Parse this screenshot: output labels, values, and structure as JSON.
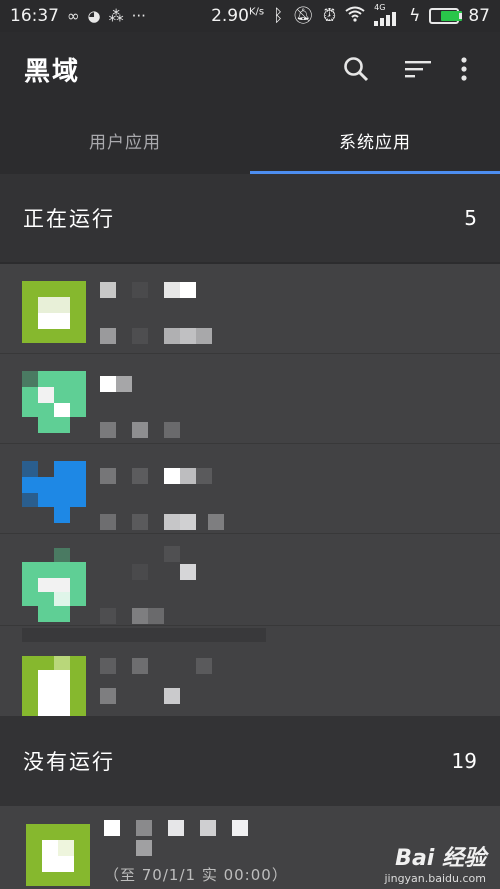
{
  "status_bar": {
    "time": "16:37",
    "speed_value": "2.90",
    "speed_unit": "K/s",
    "network": "4G",
    "battery": "87",
    "battery_level_percent": 87
  },
  "toolbar": {
    "title": "黑域",
    "icons": [
      "search-icon",
      "sort-icon",
      "more-vert-icon"
    ]
  },
  "tabs": [
    {
      "label": "用户应用",
      "active": false
    },
    {
      "label": "系统应用",
      "active": true
    }
  ],
  "running": {
    "label": "正在运行",
    "count": "5"
  },
  "not_running": {
    "label": "没有运行",
    "count": "19"
  },
  "bottom_row_text": "（至 70/1/1 实 00:00）",
  "watermark": {
    "brand": "Bai 经验",
    "url": "jingyan.baidu.com"
  },
  "colors": {
    "accent": "#4d8ef0",
    "battery": "#29c64a",
    "green_icon": "#8bc34a",
    "mint_icon": "#5fcf95",
    "blue_icon": "#1e88e5"
  }
}
